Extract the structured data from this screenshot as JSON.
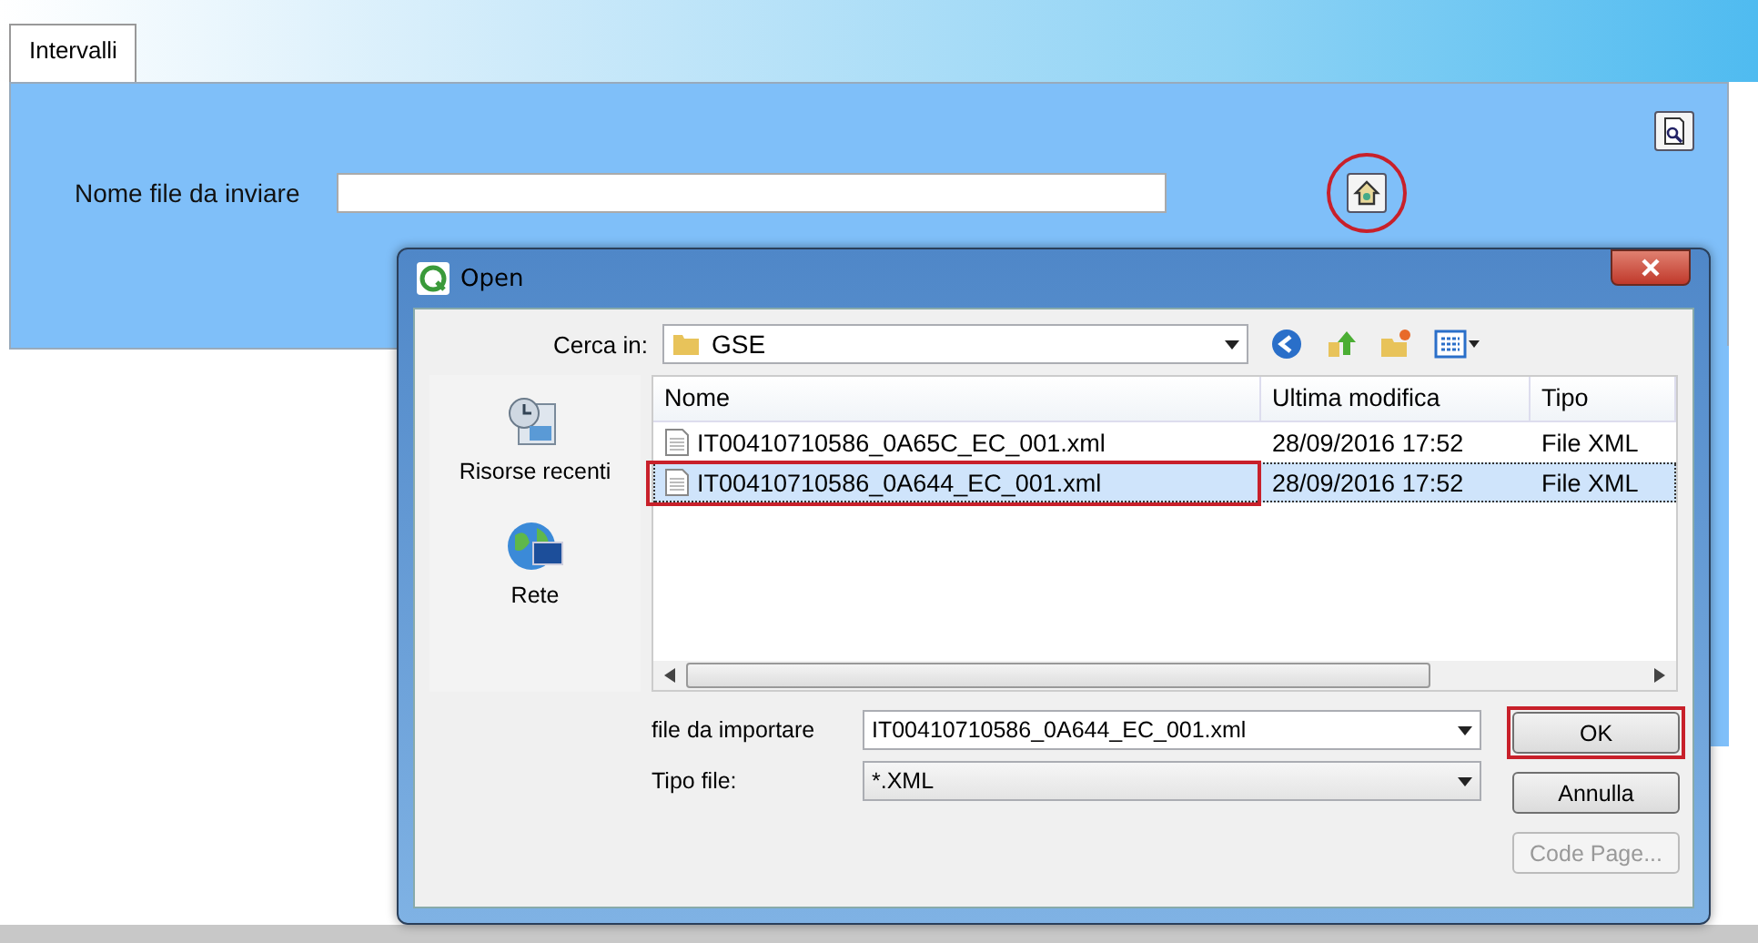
{
  "tabs": [
    {
      "label": "Intervalli",
      "selected": true
    }
  ],
  "form": {
    "label": "Nome file da inviare",
    "browse_circled": true
  },
  "dialog": {
    "title": "Open",
    "look_in_label": "Cerca in:",
    "look_in_value": "GSE",
    "places": [
      {
        "label": "Risorse recenti",
        "kind": "recent"
      },
      {
        "label": "Rete",
        "kind": "network"
      }
    ],
    "columns": [
      "Nome",
      "Ultima modifica",
      "Tipo"
    ],
    "rows": [
      {
        "name": "IT00410710586_0A65C_EC_001.xml",
        "modified": "28/09/2016 17:52",
        "type": "File XML",
        "selected": false,
        "highlighted": false
      },
      {
        "name": "IT00410710586_0A644_EC_001.xml",
        "modified": "28/09/2016 17:52",
        "type": "File XML",
        "selected": true,
        "highlighted": true
      }
    ],
    "file_label": "file da importare",
    "file_value": "IT00410710586_0A644_EC_001.xml",
    "type_label": "Tipo file:",
    "type_value": "*.XML",
    "buttons": [
      {
        "label": "OK",
        "disabled": false,
        "highlighted": true
      },
      {
        "label": "Annulla",
        "disabled": false,
        "highlighted": false
      },
      {
        "label": "Code Page...",
        "disabled": true,
        "highlighted": false
      }
    ]
  }
}
